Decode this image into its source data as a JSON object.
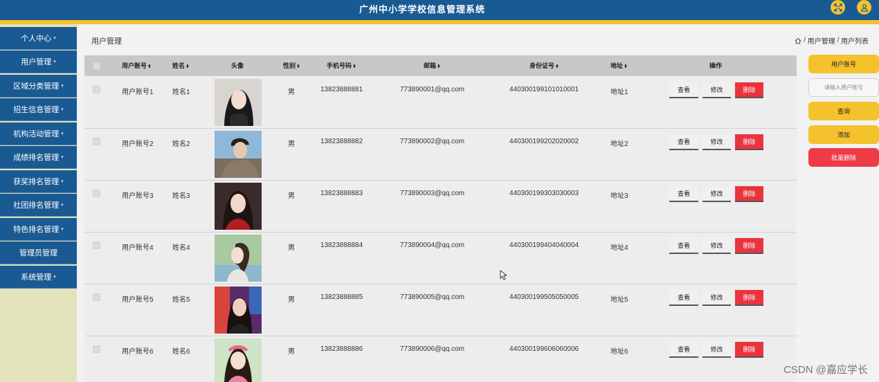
{
  "header": {
    "title": "广州中小学学校信息管理系统",
    "fullscreen_icon": "expand-icon",
    "user_icon": "user-icon"
  },
  "sidebar": {
    "items": [
      {
        "label": "个人中心"
      },
      {
        "label": "用户管理"
      },
      {
        "label": "区域分类管理"
      },
      {
        "label": "招生信息管理"
      },
      {
        "label": "机构活动管理"
      },
      {
        "label": "成绩排名管理"
      },
      {
        "label": "获奖排名管理"
      },
      {
        "label": "社团排名管理"
      },
      {
        "label": "特色排名管理"
      },
      {
        "label": "管理员管理"
      },
      {
        "label": "系统管理"
      }
    ]
  },
  "page": {
    "title": "用户管理",
    "breadcrumb": {
      "sep": "/",
      "level1": "用户管理",
      "level2": "用户列表"
    }
  },
  "table": {
    "columns": {
      "account": "用户账号",
      "name": "姓名",
      "avatar": "头像",
      "gender": "性别",
      "phone": "手机号码",
      "email": "邮箱",
      "id_card": "身份证号",
      "address": "地址",
      "actions": "操作"
    },
    "sort_glyph": "⬍",
    "action_labels": {
      "view": "查看",
      "edit": "修改",
      "delete": "删除"
    },
    "rows": [
      {
        "account": "用户账号1",
        "name": "姓名1",
        "gender": "男",
        "phone": "13823888881",
        "email": "773890001@qq.com",
        "id_card": "440300199101010001",
        "address": "地址1"
      },
      {
        "account": "用户账号2",
        "name": "姓名2",
        "gender": "男",
        "phone": "13823888882",
        "email": "773890002@qq.com",
        "id_card": "440300199202020002",
        "address": "地址2"
      },
      {
        "account": "用户账号3",
        "name": "姓名3",
        "gender": "男",
        "phone": "13823888883",
        "email": "773890003@qq.com",
        "id_card": "440300199303030003",
        "address": "地址3"
      },
      {
        "account": "用户账号4",
        "name": "姓名4",
        "gender": "男",
        "phone": "13823888884",
        "email": "773890004@qq.com",
        "id_card": "440300199404040004",
        "address": "地址4"
      },
      {
        "account": "用户账号5",
        "name": "姓名5",
        "gender": "男",
        "phone": "13823888885",
        "email": "773890005@qq.com",
        "id_card": "440300199505050005",
        "address": "地址5"
      },
      {
        "account": "用户账号6",
        "name": "姓名6",
        "gender": "男",
        "phone": "13823888886",
        "email": "773890006@qq.com",
        "id_card": "440300199606060006",
        "address": "地址6"
      }
    ]
  },
  "search_panel": {
    "field_label": "用户账号",
    "placeholder": "请输入用户账号",
    "query_label": "查询",
    "add_label": "添加",
    "batch_delete_label": "批量删除"
  },
  "watermark": "CSDN @嘉应学长",
  "colors": {
    "header_blue": "#1a5a93",
    "accent_yellow": "#f3c22d",
    "danger_red": "#e9343e",
    "sidebar_bg": "#e2e2bc"
  }
}
